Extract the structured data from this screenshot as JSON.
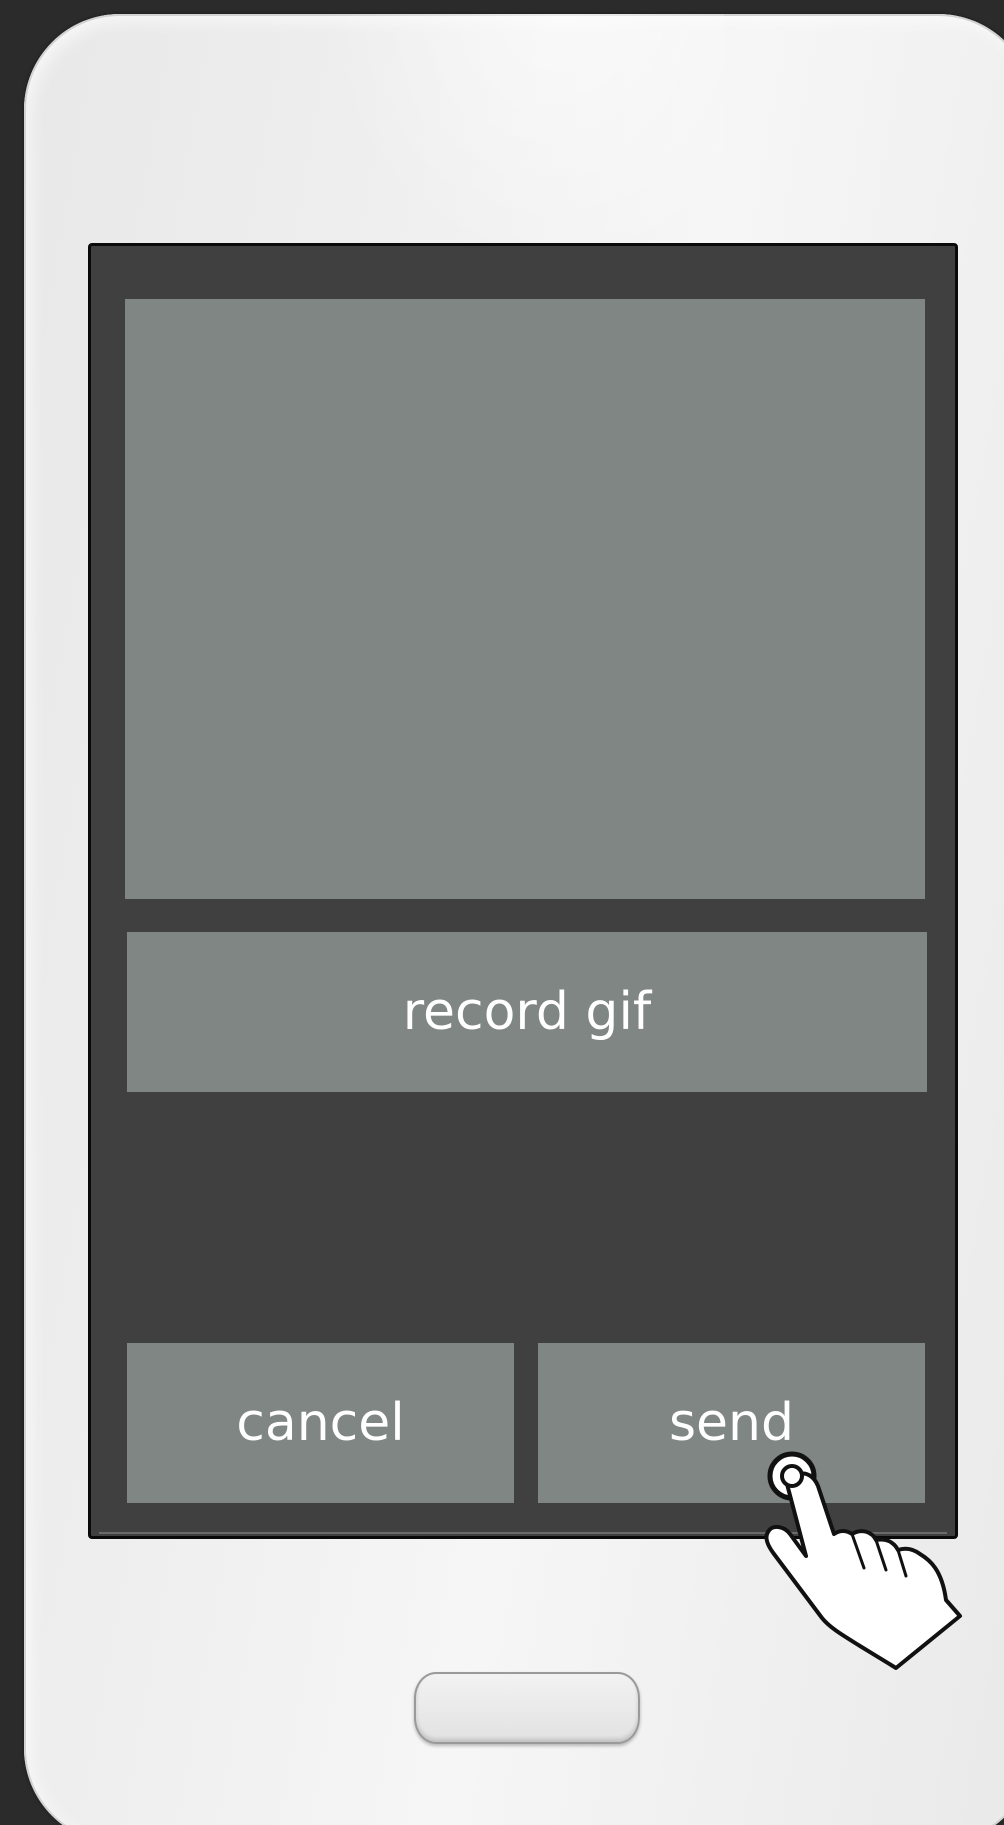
{
  "screen": {
    "record_label": "record gif",
    "cancel_label": "cancel",
    "send_label": "send"
  },
  "colors": {
    "background": "#2b2b2b",
    "screen": "#404040",
    "control": "#808684",
    "label": "#ffffff"
  },
  "icons": {
    "pointer": "hand-tap-icon"
  }
}
